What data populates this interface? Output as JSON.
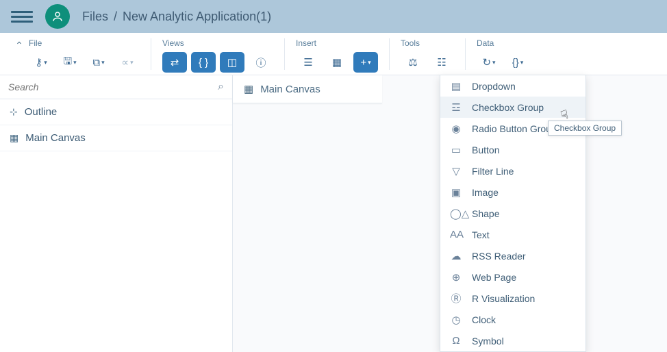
{
  "header": {
    "breadcrumb_root": "Files",
    "breadcrumb_sep": "/",
    "breadcrumb_current": "New Analytic Application(1)"
  },
  "toolbar": {
    "file_label": "File",
    "views_label": "Views",
    "insert_label": "Insert",
    "tools_label": "Tools",
    "data_label": "Data"
  },
  "left_panel": {
    "search_placeholder": "Search",
    "outline_label": "Outline",
    "main_canvas_label": "Main Canvas"
  },
  "canvas_tab": {
    "label": "Main Canvas"
  },
  "insert_menu": {
    "items": [
      {
        "label": "Dropdown",
        "glyph": "▤"
      },
      {
        "label": "Checkbox Group",
        "glyph": "☲"
      },
      {
        "label": "Radio Button Group",
        "glyph": "◉"
      },
      {
        "label": "Button",
        "glyph": "▭"
      },
      {
        "label": "Filter Line",
        "glyph": "▽"
      },
      {
        "label": "Image",
        "glyph": "▣"
      },
      {
        "label": "Shape",
        "glyph": "◯△"
      },
      {
        "label": "Text",
        "glyph": "AA"
      },
      {
        "label": "RSS Reader",
        "glyph": "☁"
      },
      {
        "label": "Web Page",
        "glyph": "⊕"
      },
      {
        "label": "R Visualization",
        "glyph": "Ⓡ"
      },
      {
        "label": "Clock",
        "glyph": "◷"
      },
      {
        "label": "Symbol",
        "glyph": "Ω"
      }
    ],
    "hover_index": 1
  },
  "tooltip_text": "Checkbox Group"
}
